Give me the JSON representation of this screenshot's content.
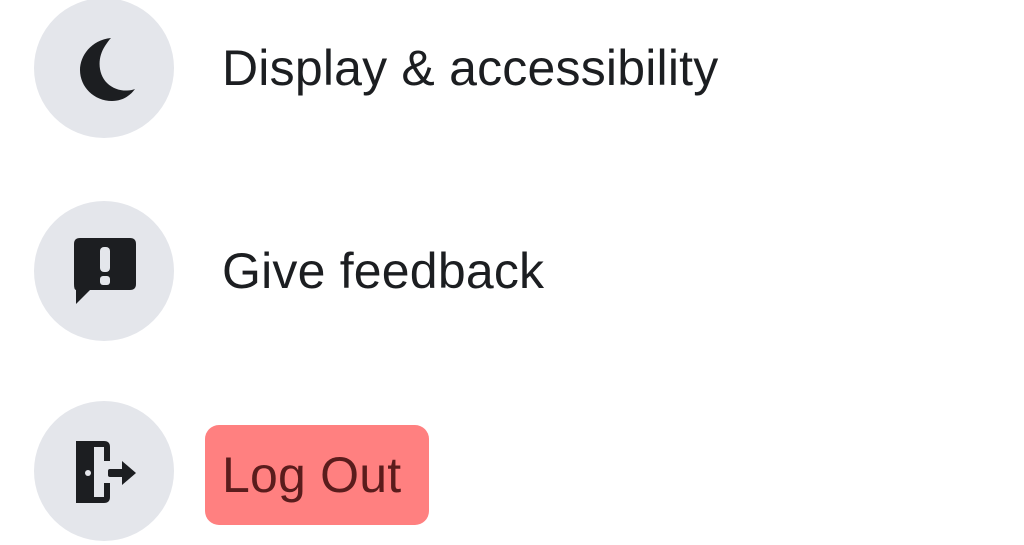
{
  "menu": {
    "items": [
      {
        "label": "Display & accessibility",
        "icon": "moon-icon"
      },
      {
        "label": "Give feedback",
        "icon": "feedback-exclamation-icon"
      },
      {
        "label": "Log Out",
        "icon": "logout-door-icon",
        "highlighted": true,
        "highlight_color": "#ff8080"
      }
    ]
  },
  "colors": {
    "icon_circle_bg": "#e4e6eb",
    "text": "#1c1e21",
    "highlight": "#ff8080"
  }
}
